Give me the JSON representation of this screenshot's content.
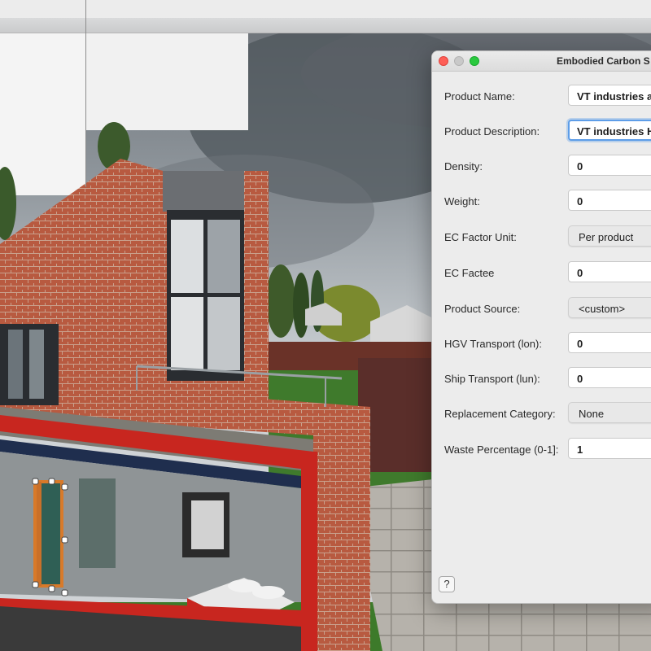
{
  "dialog": {
    "title": "Embodied Carbon S",
    "fields": [
      {
        "label": "Product Name:",
        "value": "VT industries ar",
        "kind": "text",
        "bold": true
      },
      {
        "label": "Product Description:",
        "value": "VT industries H",
        "kind": "text",
        "bold": true,
        "focused": true
      },
      {
        "label": "Density:",
        "value": "0",
        "kind": "text",
        "bold": true
      },
      {
        "label": "Weight:",
        "value": "0",
        "kind": "text",
        "bold": true
      },
      {
        "label": "EC Factor Unit:",
        "value": "Per product",
        "kind": "select"
      },
      {
        "label": "EC Factee",
        "value": "0",
        "kind": "text",
        "bold": true
      },
      {
        "label": "Product Source:",
        "value": "<custom>",
        "kind": "select"
      },
      {
        "label": "HGV Transport (lon):",
        "value": "0",
        "kind": "text",
        "bold": true
      },
      {
        "label": "Ship Transport (lun):",
        "value": "0",
        "kind": "text",
        "bold": true
      },
      {
        "label": "Replacement Category:",
        "value": "None",
        "kind": "select"
      },
      {
        "label": "Waste Percentage (0-1]:",
        "value": "1",
        "kind": "text",
        "bold": true
      }
    ],
    "help_label": "?"
  },
  "colors": {
    "brick": "#b5573f",
    "cut_red": "#c8261f",
    "focus_ring": "#5d9de8",
    "sky": "#8a9198",
    "grass": "#3f7a2c"
  }
}
